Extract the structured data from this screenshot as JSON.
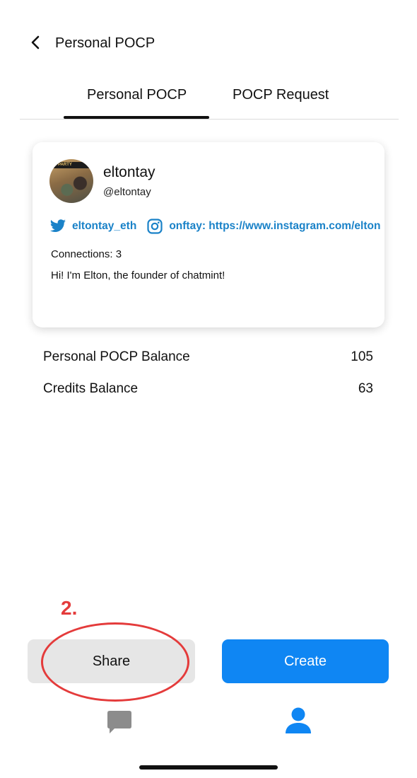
{
  "header": {
    "back_icon": "chevron-left-icon",
    "title": "Personal POCP"
  },
  "tabs": [
    {
      "label": "Personal POCP",
      "active": true
    },
    {
      "label": "POCP Request",
      "active": false
    }
  ],
  "profile": {
    "avatar_icon": "user-photo-avatar",
    "display_name": "eltontay",
    "handle": "@eltontay",
    "twitter": {
      "icon": "twitter-bird-icon",
      "text": "eltontay_eth"
    },
    "instagram": {
      "icon": "instagram-icon",
      "text": "onftay: https://www.instagram.com/elton"
    },
    "connections": "Connections: 3",
    "bio": "Hi! I'm Elton, the founder of chatmint!"
  },
  "balances": [
    {
      "label": "Personal POCP Balance",
      "value": "105"
    },
    {
      "label": "Credits Balance",
      "value": "63"
    }
  ],
  "annotation": {
    "label": "2.",
    "color": "#e43b3b"
  },
  "actions": {
    "share_label": "Share",
    "create_label": "Create"
  },
  "bottom_nav": [
    {
      "icon": "chat-bubble-icon",
      "active": false
    },
    {
      "icon": "profile-icon",
      "active": true
    }
  ],
  "colors": {
    "accent": "#0f86f3",
    "link": "#1a82c8",
    "inactive_icon": "#8c8c8c",
    "annotation": "#e43b3b"
  }
}
